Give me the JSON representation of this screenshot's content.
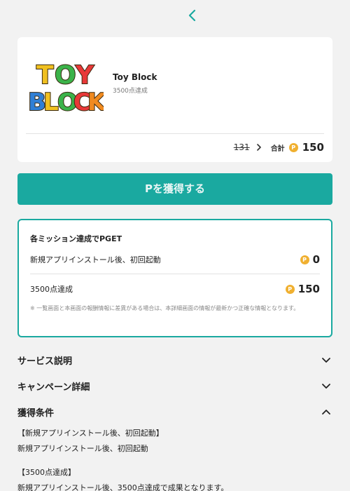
{
  "header": {
    "back_icon": "chevron-left-icon"
  },
  "app": {
    "title": "Toy Block",
    "subtitle": "3500点達成",
    "logo_lines": [
      "TOY",
      "BLOCK"
    ]
  },
  "points": {
    "old": "131",
    "total_label": "合計",
    "coin_glyph": "P",
    "total": "150"
  },
  "cta": {
    "label": "Pを獲得する"
  },
  "missions": {
    "heading": "各ミッション達成でPGET",
    "items": [
      {
        "label": "新規アプリインストール後、初回起動",
        "points": "0"
      },
      {
        "label": "3500点達成",
        "points": "150"
      }
    ],
    "note": "※ 一覧画面と本画面の報酬情報に差異がある場合は、本詳細画面の情報が最新かつ正確な情報となります。"
  },
  "sections": [
    {
      "title": "サービス説明",
      "expanded": false
    },
    {
      "title": "キャンペーン詳細",
      "expanded": false
    },
    {
      "title": "獲得条件",
      "expanded": true
    }
  ],
  "conditions": {
    "lines": [
      "【新規アプリインストール後、初回起動】",
      "新規アプリインストール後、初回起動",
      "【3500点達成】",
      "新規アプリインストール後、3500点達成で成果となります。"
    ]
  },
  "colors": {
    "accent": "#1aa9a0",
    "coin": "#f0b030",
    "background": "#f2f2f2"
  }
}
